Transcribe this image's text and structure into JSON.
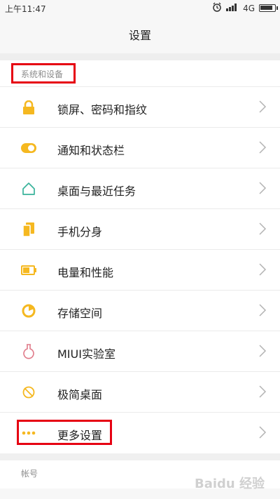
{
  "status": {
    "time": "上午11:47",
    "network": "4G"
  },
  "header": {
    "title": "设置"
  },
  "section": {
    "system": "系统和设备",
    "account": "帐号"
  },
  "items": [
    {
      "label": "锁屏、密码和指纹",
      "icon": "lock-icon",
      "color": "#f5b820"
    },
    {
      "label": "通知和状态栏",
      "icon": "toggle-icon",
      "color": "#f5b820"
    },
    {
      "label": "桌面与最近任务",
      "icon": "home-icon",
      "color": "#39b39b"
    },
    {
      "label": "手机分身",
      "icon": "phone-clone-icon",
      "color": "#f5b820"
    },
    {
      "label": "电量和性能",
      "icon": "battery-icon",
      "color": "#f5b820"
    },
    {
      "label": "存储空间",
      "icon": "storage-icon",
      "color": "#f5b820"
    },
    {
      "label": "MIUI实验室",
      "icon": "flask-icon",
      "color": "#e07b8a"
    },
    {
      "label": "极简桌面",
      "icon": "simple-home-icon",
      "color": "#f5b820"
    },
    {
      "label": "更多设置",
      "icon": "more-dots-icon",
      "color": "#f5b820"
    }
  ],
  "watermark": "Baidu 经验"
}
